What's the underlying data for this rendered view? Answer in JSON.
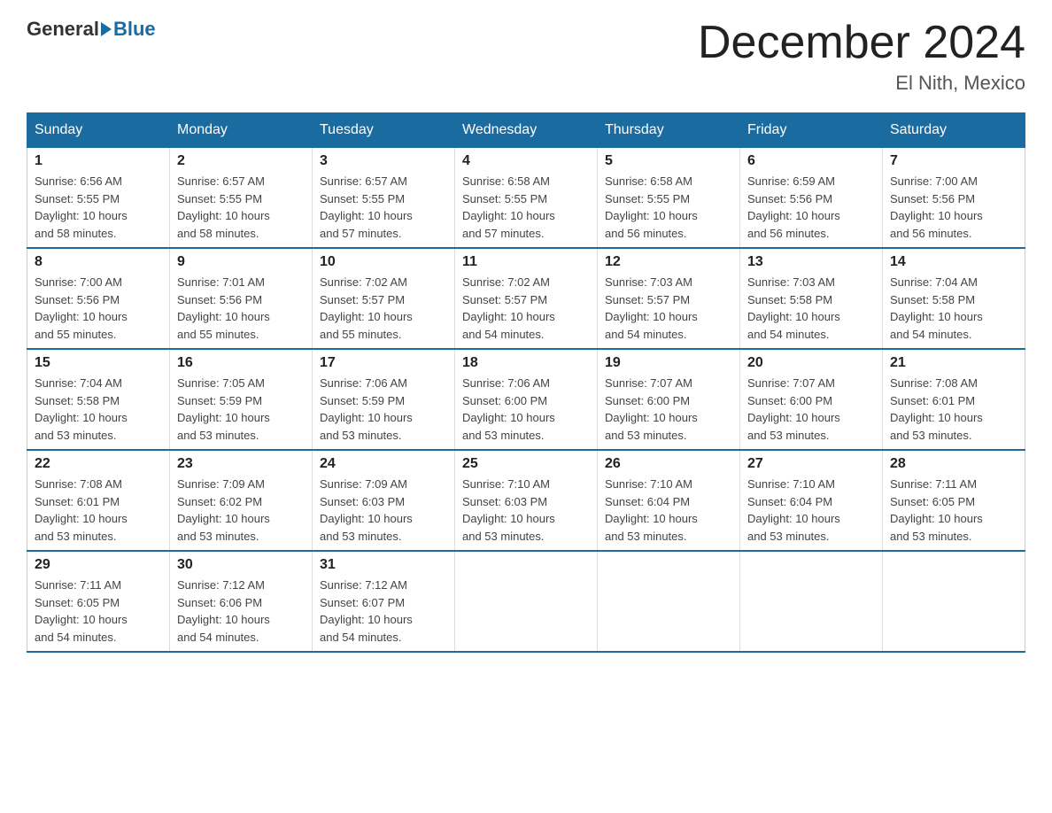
{
  "header": {
    "logo_general": "General",
    "logo_blue": "Blue",
    "title": "December 2024",
    "subtitle": "El Nith, Mexico"
  },
  "days_of_week": [
    "Sunday",
    "Monday",
    "Tuesday",
    "Wednesday",
    "Thursday",
    "Friday",
    "Saturday"
  ],
  "weeks": [
    [
      {
        "day": "1",
        "sunrise": "6:56 AM",
        "sunset": "5:55 PM",
        "daylight": "10 hours and 58 minutes."
      },
      {
        "day": "2",
        "sunrise": "6:57 AM",
        "sunset": "5:55 PM",
        "daylight": "10 hours and 58 minutes."
      },
      {
        "day": "3",
        "sunrise": "6:57 AM",
        "sunset": "5:55 PM",
        "daylight": "10 hours and 57 minutes."
      },
      {
        "day": "4",
        "sunrise": "6:58 AM",
        "sunset": "5:55 PM",
        "daylight": "10 hours and 57 minutes."
      },
      {
        "day": "5",
        "sunrise": "6:58 AM",
        "sunset": "5:55 PM",
        "daylight": "10 hours and 56 minutes."
      },
      {
        "day": "6",
        "sunrise": "6:59 AM",
        "sunset": "5:56 PM",
        "daylight": "10 hours and 56 minutes."
      },
      {
        "day": "7",
        "sunrise": "7:00 AM",
        "sunset": "5:56 PM",
        "daylight": "10 hours and 56 minutes."
      }
    ],
    [
      {
        "day": "8",
        "sunrise": "7:00 AM",
        "sunset": "5:56 PM",
        "daylight": "10 hours and 55 minutes."
      },
      {
        "day": "9",
        "sunrise": "7:01 AM",
        "sunset": "5:56 PM",
        "daylight": "10 hours and 55 minutes."
      },
      {
        "day": "10",
        "sunrise": "7:02 AM",
        "sunset": "5:57 PM",
        "daylight": "10 hours and 55 minutes."
      },
      {
        "day": "11",
        "sunrise": "7:02 AM",
        "sunset": "5:57 PM",
        "daylight": "10 hours and 54 minutes."
      },
      {
        "day": "12",
        "sunrise": "7:03 AM",
        "sunset": "5:57 PM",
        "daylight": "10 hours and 54 minutes."
      },
      {
        "day": "13",
        "sunrise": "7:03 AM",
        "sunset": "5:58 PM",
        "daylight": "10 hours and 54 minutes."
      },
      {
        "day": "14",
        "sunrise": "7:04 AM",
        "sunset": "5:58 PM",
        "daylight": "10 hours and 54 minutes."
      }
    ],
    [
      {
        "day": "15",
        "sunrise": "7:04 AM",
        "sunset": "5:58 PM",
        "daylight": "10 hours and 53 minutes."
      },
      {
        "day": "16",
        "sunrise": "7:05 AM",
        "sunset": "5:59 PM",
        "daylight": "10 hours and 53 minutes."
      },
      {
        "day": "17",
        "sunrise": "7:06 AM",
        "sunset": "5:59 PM",
        "daylight": "10 hours and 53 minutes."
      },
      {
        "day": "18",
        "sunrise": "7:06 AM",
        "sunset": "6:00 PM",
        "daylight": "10 hours and 53 minutes."
      },
      {
        "day": "19",
        "sunrise": "7:07 AM",
        "sunset": "6:00 PM",
        "daylight": "10 hours and 53 minutes."
      },
      {
        "day": "20",
        "sunrise": "7:07 AM",
        "sunset": "6:00 PM",
        "daylight": "10 hours and 53 minutes."
      },
      {
        "day": "21",
        "sunrise": "7:08 AM",
        "sunset": "6:01 PM",
        "daylight": "10 hours and 53 minutes."
      }
    ],
    [
      {
        "day": "22",
        "sunrise": "7:08 AM",
        "sunset": "6:01 PM",
        "daylight": "10 hours and 53 minutes."
      },
      {
        "day": "23",
        "sunrise": "7:09 AM",
        "sunset": "6:02 PM",
        "daylight": "10 hours and 53 minutes."
      },
      {
        "day": "24",
        "sunrise": "7:09 AM",
        "sunset": "6:03 PM",
        "daylight": "10 hours and 53 minutes."
      },
      {
        "day": "25",
        "sunrise": "7:10 AM",
        "sunset": "6:03 PM",
        "daylight": "10 hours and 53 minutes."
      },
      {
        "day": "26",
        "sunrise": "7:10 AM",
        "sunset": "6:04 PM",
        "daylight": "10 hours and 53 minutes."
      },
      {
        "day": "27",
        "sunrise": "7:10 AM",
        "sunset": "6:04 PM",
        "daylight": "10 hours and 53 minutes."
      },
      {
        "day": "28",
        "sunrise": "7:11 AM",
        "sunset": "6:05 PM",
        "daylight": "10 hours and 53 minutes."
      }
    ],
    [
      {
        "day": "29",
        "sunrise": "7:11 AM",
        "sunset": "6:05 PM",
        "daylight": "10 hours and 54 minutes."
      },
      {
        "day": "30",
        "sunrise": "7:12 AM",
        "sunset": "6:06 PM",
        "daylight": "10 hours and 54 minutes."
      },
      {
        "day": "31",
        "sunrise": "7:12 AM",
        "sunset": "6:07 PM",
        "daylight": "10 hours and 54 minutes."
      },
      null,
      null,
      null,
      null
    ]
  ],
  "labels": {
    "sunrise": "Sunrise:",
    "sunset": "Sunset:",
    "daylight": "Daylight:"
  }
}
